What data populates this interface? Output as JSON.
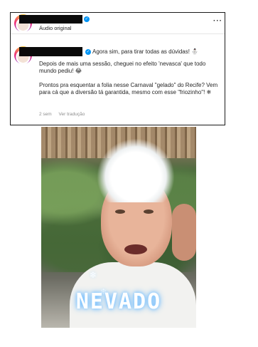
{
  "post": {
    "audio_label": "Áudio original",
    "more_label": "···"
  },
  "comment": {
    "header_text": "Agora sim, para tirar todas as dúvidas!",
    "header_emoji": "⛄",
    "paragraph1": "Depois de mais uma sessão, cheguei no efeito 'nevasca' que todo mundo pediu!",
    "paragraph1_emoji": "😂",
    "paragraph2": "Prontos pra esquentar a folia nesse Carnaval \"gelado\" do Recife? Vem para cá que a diversão tá garantida, mesmo com esse \"friozinho\"!",
    "paragraph2_emoji": "❄",
    "time_ago": "2 sem",
    "translate_label": "Ver tradução"
  },
  "video": {
    "overlay_text": "NEVADO",
    "snowflake_icon": "❄"
  },
  "colors": {
    "verified": "#0095f6",
    "overlay_glow": "#4aa8ff"
  }
}
